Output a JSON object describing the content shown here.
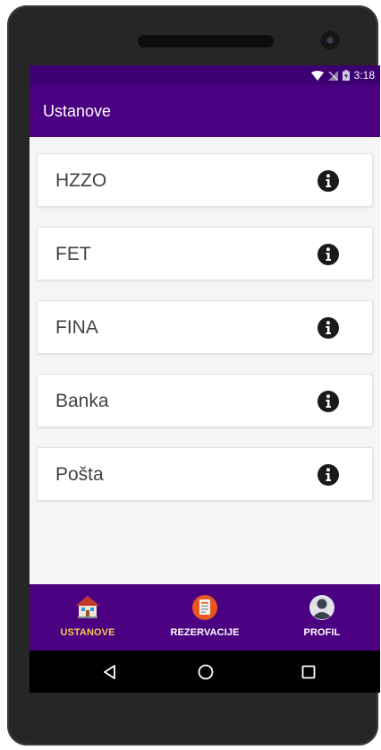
{
  "status_bar": {
    "time": "3:18"
  },
  "app_bar": {
    "title": "Ustanove"
  },
  "institutions": [
    {
      "label": "HZZO"
    },
    {
      "label": "FET"
    },
    {
      "label": "FINA"
    },
    {
      "label": "Banka"
    },
    {
      "label": "Pošta"
    }
  ],
  "bottom_nav": {
    "items": [
      {
        "label": "USTANOVE",
        "icon": "building-icon",
        "active": true
      },
      {
        "label": "REZERVACIJE",
        "icon": "document-icon",
        "active": false
      },
      {
        "label": "PROFIL",
        "icon": "person-icon",
        "active": false
      }
    ]
  },
  "colors": {
    "primary": "#4b0082",
    "primary_dark": "#3d0072",
    "active_label": "#f2c94c",
    "inactive_label": "#ffffff",
    "background": "#f5f5f5"
  }
}
